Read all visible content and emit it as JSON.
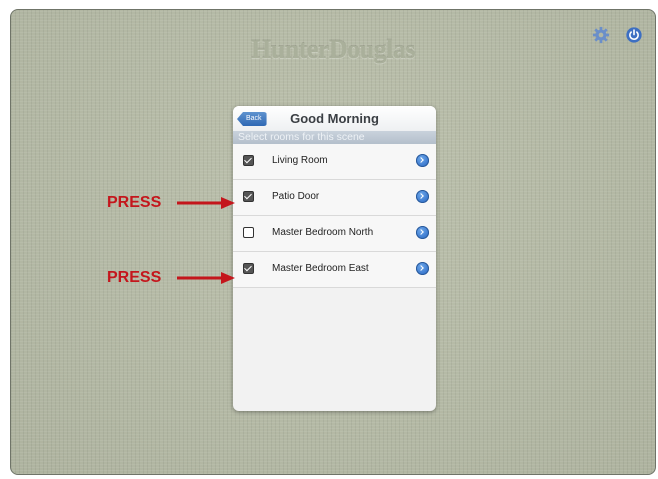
{
  "header": {
    "brand_text": "HunterDouglas",
    "icons": [
      "gear-icon",
      "power-icon"
    ]
  },
  "panel": {
    "back_label": "Back",
    "title": "Good Morning",
    "subtitle": "Select rooms for this scene",
    "rooms": [
      {
        "label": "Living Room",
        "checked": true
      },
      {
        "label": "Patio Door",
        "checked": true
      },
      {
        "label": "Master Bedroom North",
        "checked": false
      },
      {
        "label": "Master Bedroom East",
        "checked": true
      }
    ]
  },
  "annotations": {
    "callout_1": "PRESS",
    "callout_2": "PRESS",
    "color": "#c4161c"
  },
  "colors": {
    "background": "#b3b8a4",
    "accent_blue": "#2f68b4"
  }
}
